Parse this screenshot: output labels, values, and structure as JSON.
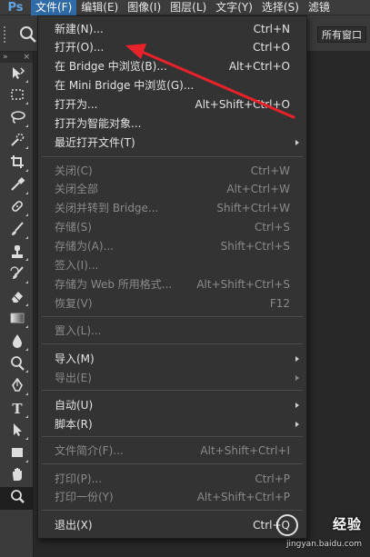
{
  "app": {
    "logo": "Ps"
  },
  "menubar": {
    "items": [
      {
        "label": "文件(F)",
        "active": true
      },
      {
        "label": "编辑(E)",
        "active": false
      },
      {
        "label": "图像(I)",
        "active": false
      },
      {
        "label": "图层(L)",
        "active": false
      },
      {
        "label": "文字(Y)",
        "active": false
      },
      {
        "label": "选择(S)",
        "active": false
      },
      {
        "label": "滤镜",
        "active": false
      }
    ]
  },
  "options_bar": {
    "right_label": "所有窗口"
  },
  "file_menu": {
    "items": [
      {
        "label": "新建(N)...",
        "shortcut": "Ctrl+N",
        "enabled": true,
        "submenu": false
      },
      {
        "label": "打开(O)...",
        "shortcut": "Ctrl+O",
        "enabled": true,
        "submenu": false
      },
      {
        "label": "在 Bridge 中浏览(B)...",
        "shortcut": "Alt+Ctrl+O",
        "enabled": true,
        "submenu": false
      },
      {
        "label": "在 Mini Bridge 中浏览(G)...",
        "shortcut": "",
        "enabled": true,
        "submenu": false
      },
      {
        "label": "打开为...",
        "shortcut": "Alt+Shift+Ctrl+O",
        "enabled": true,
        "submenu": false
      },
      {
        "label": "打开为智能对象...",
        "shortcut": "",
        "enabled": true,
        "submenu": false
      },
      {
        "label": "最近打开文件(T)",
        "shortcut": "",
        "enabled": true,
        "submenu": true
      },
      {
        "label": "关闭(C)",
        "shortcut": "Ctrl+W",
        "enabled": false,
        "submenu": false
      },
      {
        "label": "关闭全部",
        "shortcut": "Alt+Ctrl+W",
        "enabled": false,
        "submenu": false
      },
      {
        "label": "关闭并转到 Bridge...",
        "shortcut": "Shift+Ctrl+W",
        "enabled": false,
        "submenu": false
      },
      {
        "label": "存储(S)",
        "shortcut": "Ctrl+S",
        "enabled": false,
        "submenu": false
      },
      {
        "label": "存储为(A)...",
        "shortcut": "Shift+Ctrl+S",
        "enabled": false,
        "submenu": false
      },
      {
        "label": "签入(I)...",
        "shortcut": "",
        "enabled": false,
        "submenu": false
      },
      {
        "label": "存储为 Web 所用格式...",
        "shortcut": "Alt+Shift+Ctrl+S",
        "enabled": false,
        "submenu": false
      },
      {
        "label": "恢复(V)",
        "shortcut": "F12",
        "enabled": false,
        "submenu": false
      },
      {
        "label": "置入(L)...",
        "shortcut": "",
        "enabled": false,
        "submenu": false
      },
      {
        "label": "导入(M)",
        "shortcut": "",
        "enabled": true,
        "submenu": true
      },
      {
        "label": "导出(E)",
        "shortcut": "",
        "enabled": false,
        "submenu": true
      },
      {
        "label": "自动(U)",
        "shortcut": "",
        "enabled": true,
        "submenu": true
      },
      {
        "label": "脚本(R)",
        "shortcut": "",
        "enabled": true,
        "submenu": true
      },
      {
        "label": "文件简介(F)...",
        "shortcut": "Alt+Shift+Ctrl+I",
        "enabled": false,
        "submenu": false
      },
      {
        "label": "打印(P)...",
        "shortcut": "Ctrl+P",
        "enabled": false,
        "submenu": false
      },
      {
        "label": "打印一份(Y)",
        "shortcut": "Alt+Shift+Ctrl+P",
        "enabled": false,
        "submenu": false
      },
      {
        "label": "退出(X)",
        "shortcut": "Ctrl+Q",
        "enabled": true,
        "submenu": false
      }
    ]
  },
  "tools": [
    "move-tool-icon",
    "marquee-tool-icon",
    "lasso-tool-icon",
    "quick-select-tool-icon",
    "crop-tool-icon",
    "eyedropper-tool-icon",
    "healing-brush-tool-icon",
    "brush-tool-icon",
    "clone-stamp-tool-icon",
    "history-brush-tool-icon",
    "eraser-tool-icon",
    "gradient-tool-icon",
    "blur-tool-icon",
    "dodge-tool-icon",
    "pen-tool-icon",
    "type-tool-icon",
    "path-select-tool-icon",
    "rectangle-tool-icon",
    "hand-tool-icon",
    "zoom-tool-icon"
  ],
  "watermark": {
    "brand": "经验",
    "url": "jingyan.baidu.com"
  },
  "colors": {
    "menu_bg": "#333333",
    "highlight": "#2f6ba8",
    "annotation_arrow": "#e8222a",
    "logo": "#5fa7e6"
  }
}
